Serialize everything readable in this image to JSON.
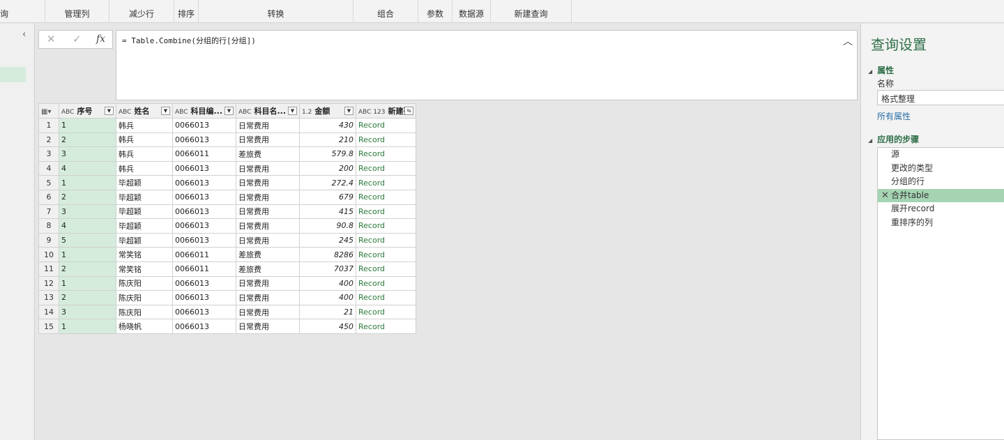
{
  "ribbon": {
    "groups": [
      "询",
      "管理列",
      "减少行",
      "排序",
      "转换",
      "组合",
      "参数",
      "数据源",
      "新建查询"
    ]
  },
  "formula_bar": {
    "cancel_icon": "✕",
    "confirm_icon": "✓",
    "fx_label": "fx",
    "formula": "= Table.Combine(分组的行[分组])",
    "expand_icon": "chevron-up-icon"
  },
  "grid": {
    "columns": [
      {
        "type": "ABC",
        "name": "序号"
      },
      {
        "type": "ABC",
        "name": "姓名"
      },
      {
        "type": "ABC",
        "name": "科目编..."
      },
      {
        "type": "ABC",
        "name": "科目名..."
      },
      {
        "type": "1.2",
        "name": "金额"
      },
      {
        "type": "ABC 123",
        "name": "新建列"
      }
    ],
    "rows": [
      [
        "1",
        "1",
        "韩兵",
        "0066013",
        "日常费用",
        "430",
        "Record"
      ],
      [
        "2",
        "2",
        "韩兵",
        "0066013",
        "日常费用",
        "210",
        "Record"
      ],
      [
        "3",
        "3",
        "韩兵",
        "0066011",
        "差旅费",
        "579.8",
        "Record"
      ],
      [
        "4",
        "4",
        "韩兵",
        "0066013",
        "日常费用",
        "200",
        "Record"
      ],
      [
        "5",
        "1",
        "毕超颖",
        "0066013",
        "日常费用",
        "272.4",
        "Record"
      ],
      [
        "6",
        "2",
        "毕超颖",
        "0066013",
        "日常费用",
        "679",
        "Record"
      ],
      [
        "7",
        "3",
        "毕超颖",
        "0066013",
        "日常费用",
        "415",
        "Record"
      ],
      [
        "8",
        "4",
        "毕超颖",
        "0066013",
        "日常费用",
        "90.8",
        "Record"
      ],
      [
        "9",
        "5",
        "毕超颖",
        "0066013",
        "日常费用",
        "245",
        "Record"
      ],
      [
        "10",
        "1",
        "常笑铭",
        "0066011",
        "差旅费",
        "8286",
        "Record"
      ],
      [
        "11",
        "2",
        "常笑铭",
        "0066011",
        "差旅费",
        "7037",
        "Record"
      ],
      [
        "12",
        "1",
        "陈庆阳",
        "0066013",
        "日常费用",
        "400",
        "Record"
      ],
      [
        "13",
        "2",
        "陈庆阳",
        "0066013",
        "日常费用",
        "400",
        "Record"
      ],
      [
        "14",
        "3",
        "陈庆阳",
        "0066013",
        "日常费用",
        "21",
        "Record"
      ],
      [
        "15",
        "1",
        "杨晓帆",
        "0066013",
        "日常费用",
        "450",
        "Record"
      ]
    ]
  },
  "right_pane": {
    "title": "查询设置",
    "properties_label": "属性",
    "name_label": "名称",
    "name_value": "格式整理",
    "all_properties": "所有属性",
    "steps_label": "应用的步骤",
    "steps": [
      "源",
      "更改的类型",
      "分组的行",
      "合并table",
      "展开record",
      "重排序的列"
    ],
    "selected_step": 3
  },
  "colors": {
    "accent": "#2f6e47",
    "selected_column": "#d5ecdc",
    "selected_step": "#a6d4b3",
    "record_text": "#2a7a3a"
  }
}
